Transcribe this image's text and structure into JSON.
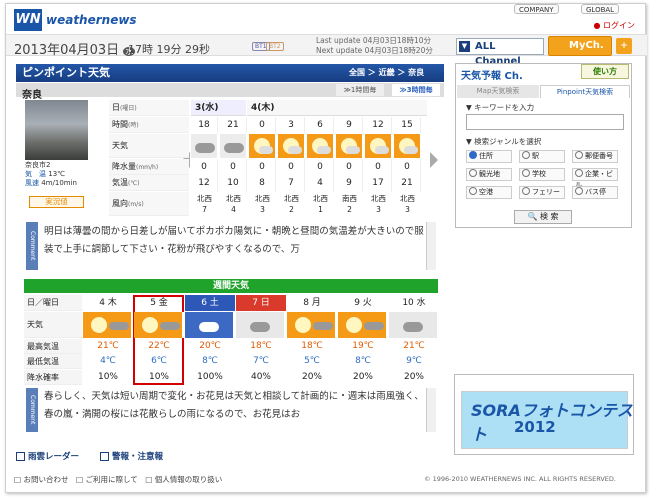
{
  "brand": {
    "logo": "WN",
    "name": "weathernews"
  },
  "top_links": {
    "company": "COMPANY",
    "global": "GLOBAL",
    "login": "ログイン"
  },
  "header": {
    "date": "2013年04月03日",
    "weekday": "水",
    "time": "17時 19分 29秒",
    "badge1": "BT1",
    "badge2": "BT2",
    "update1": "Last update  04月03日18時10分",
    "update2": "Next update  04月03日18時20分",
    "all_channel": "ALL Channel",
    "mych": "MyCh.",
    "plus": "+"
  },
  "pinpoint": {
    "title": "ピンポイント天気",
    "crumbs": "全国 ＞ 近畿 ＞ 奈良",
    "place": "奈良",
    "tab_1h": "≫1時間毎",
    "tab_3h": "≫3時間毎",
    "camera": {
      "name": "奈良市2",
      "temp_label": "気　温",
      "temp": "13℃",
      "wind_label": "風速",
      "wind": "4m/10min",
      "live": "実況値"
    },
    "row_labels": [
      {
        "t": "日",
        "u": "(曜日)"
      },
      {
        "t": "時間",
        "u": "(時)"
      },
      {
        "t": "天気",
        "u": ""
      },
      {
        "t": "降水量",
        "u": "(mm/h)"
      },
      {
        "t": "気温",
        "u": "(℃)"
      },
      {
        "t": "風向",
        "u": "(m/s)"
      }
    ],
    "day1": "3(水)",
    "day2": "4(木)",
    "hours": [
      "18",
      "21",
      "0",
      "3",
      "6",
      "9",
      "12",
      "15"
    ],
    "weather": [
      "cloud",
      "cloud",
      "sun",
      "sun",
      "sun",
      "sun",
      "sun",
      "sun"
    ],
    "precip": [
      "0",
      "0",
      "0",
      "0",
      "0",
      "0",
      "0",
      "0"
    ],
    "temps": [
      "12",
      "10",
      "8",
      "7",
      "4",
      "9",
      "17",
      "21"
    ],
    "wind_dir": [
      "北西",
      "北西",
      "北西",
      "北西",
      "北西",
      "南西",
      "北西",
      "北西"
    ],
    "wind_speed": [
      "7",
      "4",
      "3",
      "2",
      "1",
      "2",
      "3",
      "3"
    ],
    "comment_label": "Comment",
    "comment": "明日は薄曇の間から日差しが届いてポカポカ陽気に・朝晩と昼間の気温差が大きいので服装で上手に調節して下さい・花粉が飛びやすくなるので、万"
  },
  "weekly": {
    "title": "週間天気",
    "labels": [
      "日／曜日",
      "天気",
      "最高気温",
      "最低気温",
      "降水確率"
    ],
    "days": [
      {
        "d": "4 木",
        "type": "normal",
        "icon": "sun",
        "hi": "21℃",
        "lo": "4℃",
        "pop": "10%"
      },
      {
        "d": "5 金",
        "type": "normal",
        "icon": "sun",
        "hi": "22℃",
        "lo": "6℃",
        "pop": "10%"
      },
      {
        "d": "6 土",
        "type": "sat",
        "icon": "rain",
        "hi": "20℃",
        "lo": "8℃",
        "pop": "100%"
      },
      {
        "d": "7 日",
        "type": "sun",
        "icon": "cloud",
        "hi": "18℃",
        "lo": "7℃",
        "pop": "40%"
      },
      {
        "d": "8 月",
        "type": "normal",
        "icon": "sun",
        "hi": "18℃",
        "lo": "5℃",
        "pop": "20%"
      },
      {
        "d": "9 火",
        "type": "normal",
        "icon": "sun",
        "hi": "19℃",
        "lo": "8℃",
        "pop": "20%"
      },
      {
        "d": "10 水",
        "type": "normal",
        "icon": "cloud",
        "hi": "21℃",
        "lo": "9℃",
        "pop": "20%"
      }
    ],
    "comment_label": "Comment",
    "comment": "春らしく、天気は短い周期で変化・お花見は天気と相談して計画的に・週末は雨風強く、春の嵐・満開の桜には花散らしの雨になるので、お花見はお"
  },
  "bottom_tabs": [
    "雨雲レーダー",
    "警報・注意報"
  ],
  "footer": {
    "links": "お問い合わせ　□ ご利用に際して　□ 個人情報の取り扱い",
    "copyright": "© 1996-2010 WEATHERNEWS INC. ALL RIGHTS RESERVED."
  },
  "right": {
    "title": "天気予報 Ch.",
    "howto": "使い方",
    "tab1": "Map天気検索",
    "tab2": "Pinpoint天気検索",
    "kw_label": "▼ キーワードを入力",
    "genre_label": "▼ 検索ジャンルを選択",
    "genres": [
      "住所",
      "駅",
      "郵便番号",
      "観光地",
      "学校",
      "企業・ビル",
      "空港",
      "フェリー",
      "バス停"
    ],
    "search": "検 索",
    "ad_line1": "SORAフォトコンテスト",
    "ad_line2": "2012"
  }
}
